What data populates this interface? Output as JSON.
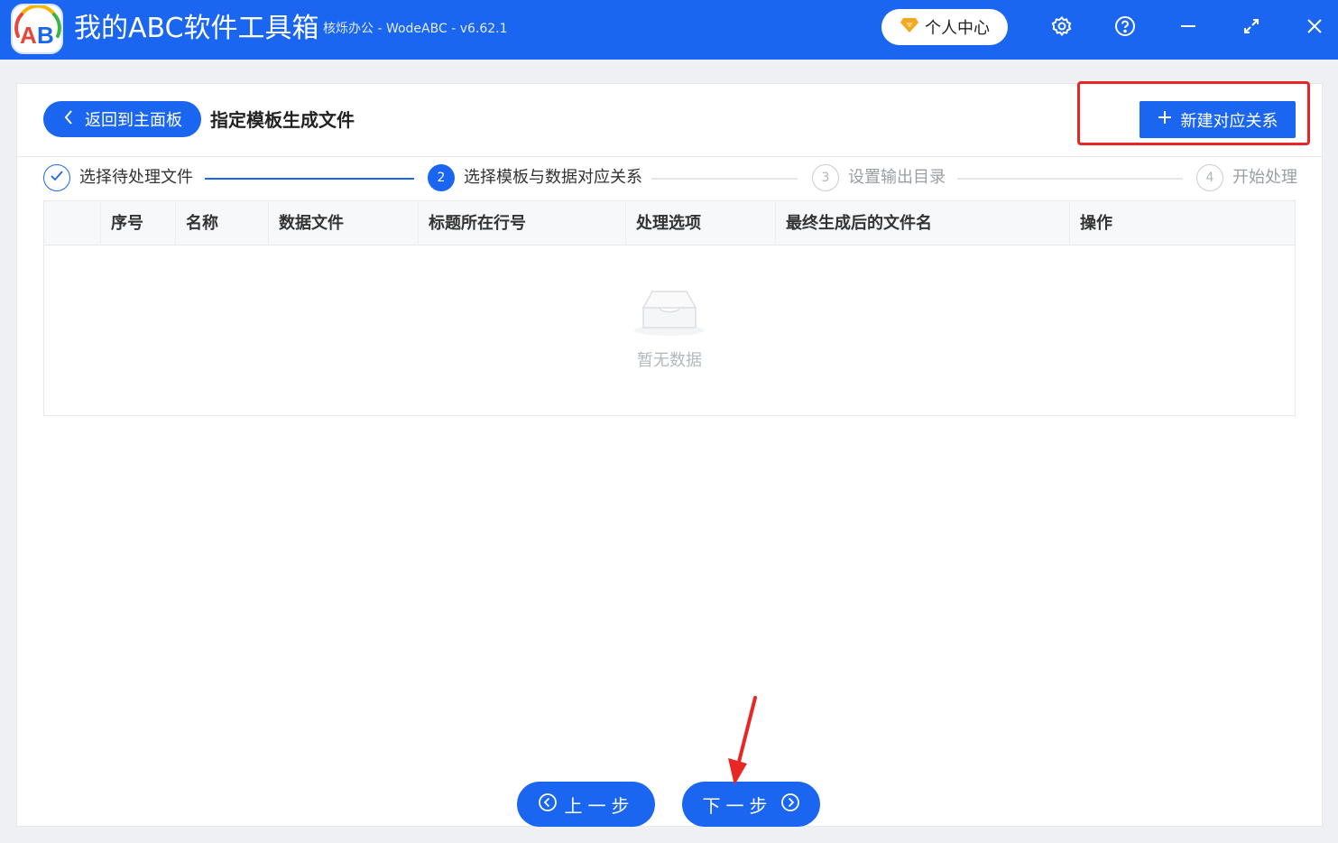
{
  "titlebar": {
    "app_name": "我的ABC软件工具箱",
    "subtitle": "核烁办公 - WodeABC - v6.62.1",
    "logo_text": "AB",
    "user_center_label": "个人中心",
    "icons": [
      "gear-icon",
      "help-icon",
      "minimize-icon",
      "maximize-icon",
      "close-icon"
    ]
  },
  "header": {
    "back_label": "返回到主面板",
    "page_title": "指定模板生成文件",
    "new_button_label": "新建对应关系"
  },
  "steps": [
    {
      "number": "1",
      "label": "选择待处理文件",
      "state": "done"
    },
    {
      "number": "2",
      "label": "选择模板与数据对应关系",
      "state": "active"
    },
    {
      "number": "3",
      "label": "设置输出目录",
      "state": "wait"
    },
    {
      "number": "4",
      "label": "开始处理",
      "state": "wait"
    }
  ],
  "table": {
    "columns": [
      "序号",
      "名称",
      "数据文件",
      "标题所在行号",
      "处理选项",
      "最终生成后的文件名",
      "操作"
    ],
    "rows": [],
    "empty_text": "暂无数据"
  },
  "footer": {
    "prev_label": "上一步",
    "next_label": "下一步"
  },
  "colors": {
    "primary": "#1a66f0",
    "annotation_red": "#e82626"
  }
}
